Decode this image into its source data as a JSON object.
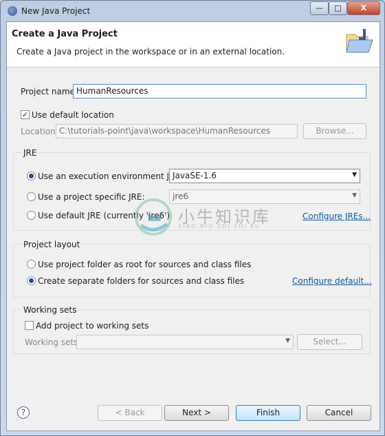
{
  "window": {
    "title": "New Java Project",
    "minimize": "—",
    "maximize": "□",
    "close": "X"
  },
  "header": {
    "title": "Create a Java Project",
    "description": "Create a Java project in the workspace or in an external location."
  },
  "project_name": {
    "label": "Project name:",
    "value": "HumanResources"
  },
  "use_default_location": {
    "label": "Use default location",
    "checked": true
  },
  "location": {
    "label": "Location:",
    "value": "C:\\tutorials-point\\java\\workspace\\HumanResources",
    "browse": "Browse..."
  },
  "jre": {
    "title": "JRE",
    "options": [
      {
        "label": "Use an execution environment JRE:",
        "selected": true,
        "value": "JavaSE-1.6"
      },
      {
        "label": "Use a project specific JRE:",
        "selected": false,
        "value": "jre6"
      },
      {
        "label": "Use default JRE (currently 'jre6')",
        "selected": false
      }
    ],
    "configure_link": "Configure JREs..."
  },
  "layout": {
    "title": "Project layout",
    "options": [
      {
        "label": "Use project folder as root for sources and class files",
        "selected": false
      },
      {
        "label": "Create separate folders for sources and class files",
        "selected": true
      }
    ],
    "configure_link": "Configure default..."
  },
  "working_sets": {
    "title": "Working sets",
    "add_label": "Add project to working sets",
    "checked": false,
    "label": "Working sets:",
    "value": "",
    "select": "Select..."
  },
  "buttons": {
    "help": "?",
    "back": "< Back",
    "next": "Next >",
    "finish": "Finish",
    "cancel": "Cancel"
  },
  "watermark": {
    "chinese": "小牛知识库",
    "pinyin": "XIAO NIU ZHI SHI KU"
  }
}
